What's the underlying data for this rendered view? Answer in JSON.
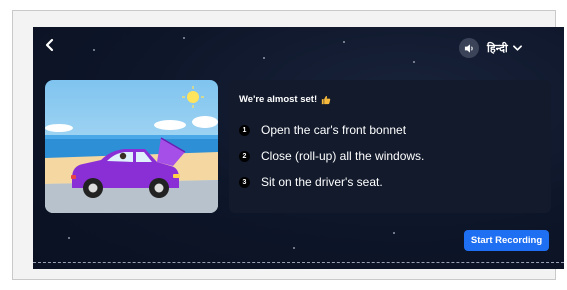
{
  "header": {
    "language_label": "हिन्दी",
    "sound_icon": "speaker-icon",
    "back_icon": "chevron-left-icon",
    "language_dropdown_icon": "chevron-down-icon"
  },
  "instructions": {
    "title": "We're almost set!",
    "title_icon": "thumbs-up-icon",
    "steps": [
      {
        "number": "1",
        "text": "Open the car's front bonnet"
      },
      {
        "number": "2",
        "text": "Close (roll-up) all the windows."
      },
      {
        "number": "3",
        "text": "Sit on the driver's seat."
      }
    ]
  },
  "illustration": {
    "icon": "car-with-open-bonnet-illustration"
  },
  "actions": {
    "start_recording_label": "Start Recording"
  },
  "colors": {
    "panel_background": "#0d1528",
    "card_background": "#121a2c",
    "primary_button": "#1f6ff2"
  }
}
